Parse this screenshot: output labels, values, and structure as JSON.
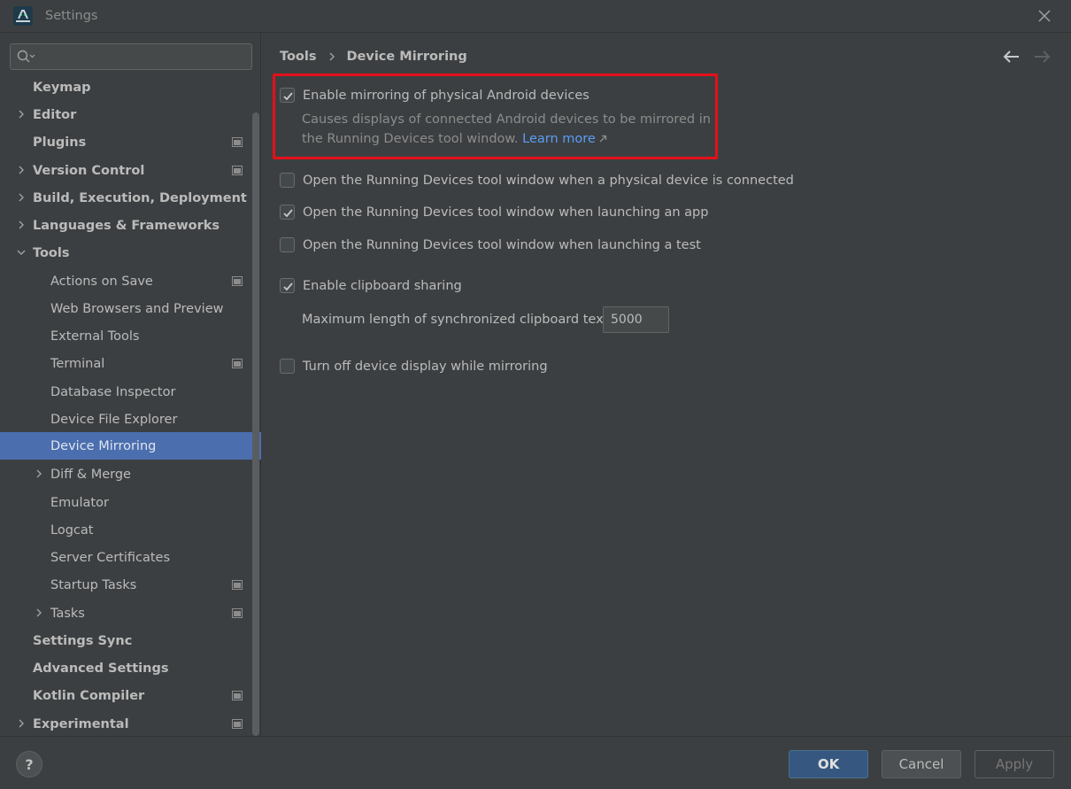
{
  "window": {
    "title": "Settings"
  },
  "search": {
    "placeholder": ""
  },
  "sidebar": {
    "items": [
      {
        "label": "Keymap"
      },
      {
        "label": "Editor"
      },
      {
        "label": "Plugins"
      },
      {
        "label": "Version Control"
      },
      {
        "label": "Build, Execution, Deployment"
      },
      {
        "label": "Languages & Frameworks"
      },
      {
        "label": "Tools"
      },
      {
        "label": "Actions on Save"
      },
      {
        "label": "Web Browsers and Preview"
      },
      {
        "label": "External Tools"
      },
      {
        "label": "Terminal"
      },
      {
        "label": "Database Inspector"
      },
      {
        "label": "Device File Explorer"
      },
      {
        "label": "Device Mirroring"
      },
      {
        "label": "Diff & Merge"
      },
      {
        "label": "Emulator"
      },
      {
        "label": "Logcat"
      },
      {
        "label": "Server Certificates"
      },
      {
        "label": "Startup Tasks"
      },
      {
        "label": "Tasks"
      },
      {
        "label": "Settings Sync"
      },
      {
        "label": "Advanced Settings"
      },
      {
        "label": "Kotlin Compiler"
      },
      {
        "label": "Experimental"
      }
    ],
    "selected": "Device Mirroring"
  },
  "breadcrumb": {
    "parent": "Tools",
    "current": "Device Mirroring"
  },
  "options": {
    "enable_mirroring": {
      "label": "Enable mirroring of physical Android devices",
      "checked": true
    },
    "enable_mirroring_desc_1": "Causes displays of connected Android devices to be mirrored in",
    "enable_mirroring_desc_2": "the Running Devices tool window.",
    "learn_more": "Learn more",
    "open_on_connect": {
      "label": "Open the Running Devices tool window when a physical device is connected",
      "checked": false
    },
    "open_on_launch_app": {
      "label": "Open the Running Devices tool window when launching an app",
      "checked": true
    },
    "open_on_launch_test": {
      "label": "Open the Running Devices tool window when launching a test",
      "checked": false
    },
    "clipboard_sharing": {
      "label": "Enable clipboard sharing",
      "checked": true
    },
    "max_clipboard_label": "Maximum length of synchronized clipboard text:",
    "max_clipboard_value": "5000",
    "turn_off_display": {
      "label": "Turn off device display while mirroring",
      "checked": false
    }
  },
  "footer": {
    "help": "?",
    "ok": "OK",
    "cancel": "Cancel",
    "apply": "Apply"
  },
  "colors": {
    "accent": "#4b6eaf",
    "highlight_border": "#e3101a",
    "link": "#589df6"
  }
}
